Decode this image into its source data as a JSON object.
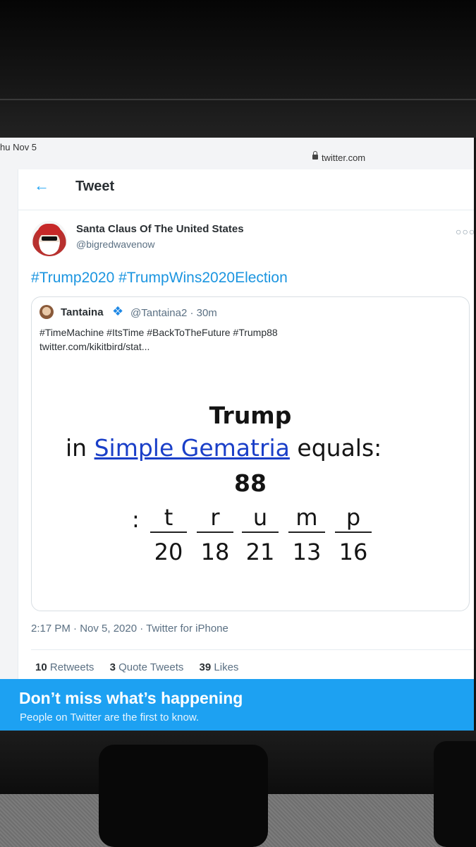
{
  "status_bar": {
    "date": "hu Nov 5",
    "url": "twitter.com"
  },
  "header": {
    "title": "Tweet"
  },
  "tweet": {
    "author_name": "Santa Claus Of The United States",
    "author_handle": "@bigredwavenow",
    "text": "#Trump2020 #TrumpWins2020Election",
    "timestamp": "2:17 PM · Nov 5, 2020 · Twitter for iPhone"
  },
  "quote": {
    "name": "Tantaina",
    "meta": "@Tantaina2 · 30m",
    "text": "#TimeMachine #ItsTime #BackToTheFuture #Trump88",
    "link": "twitter.com/kikitbird/stat...",
    "image": {
      "title": "Trump",
      "line_prefix": "in",
      "line_link": "Simple Gematria",
      "line_suffix": "equals:",
      "total": "88",
      "colon": ":",
      "letters": [
        "t",
        "r",
        "u",
        "m",
        "p"
      ],
      "numbers": [
        "20",
        "18",
        "21",
        "13",
        "16"
      ]
    }
  },
  "stats": {
    "retweets_count": "10",
    "retweets_label": "Retweets",
    "quotes_count": "3",
    "quotes_label": "Quote Tweets",
    "likes_count": "39",
    "likes_label": "Likes"
  },
  "banner": {
    "title": "Don’t miss what’s happening",
    "subtitle": "People on Twitter are the first to know."
  },
  "icons": [
    "back-arrow-icon",
    "lock-icon",
    "more-icon",
    "butterfly-icon"
  ],
  "colors": {
    "accent": "#1da1f2",
    "link": "#1b95e0",
    "gematria_link": "#1a3fc8"
  }
}
